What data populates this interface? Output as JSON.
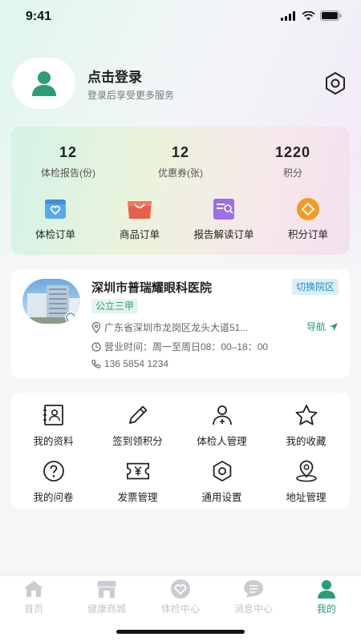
{
  "status_bar": {
    "time": "9:41"
  },
  "profile": {
    "title": "点击登录",
    "subtitle": "登录后享受更多服务"
  },
  "stats": [
    {
      "value": "12",
      "label": "体检报告(份)"
    },
    {
      "value": "12",
      "label": "优惠券(张)"
    },
    {
      "value": "1220",
      "label": "积分"
    }
  ],
  "orders": [
    {
      "label": "体检订单",
      "icon": "exam-order-icon"
    },
    {
      "label": "商品订单",
      "icon": "shopping-bag-icon"
    },
    {
      "label": "报告解读订单",
      "icon": "report-icon"
    },
    {
      "label": "积分订单",
      "icon": "points-icon"
    }
  ],
  "hospital": {
    "name": "深圳市普瑞耀眼科医院",
    "switch_label": "切换院区",
    "grade": "公立三甲",
    "address": "广东省深圳市龙岗区龙头大道51...",
    "nav_label": "导航",
    "hours": "营业时间：周一至周日08：00–18：00",
    "phone": "136 5854 1234"
  },
  "menu": [
    {
      "label": "我的资料",
      "icon": "profile-card-icon"
    },
    {
      "label": "签到领积分",
      "icon": "pencil-icon"
    },
    {
      "label": "体检人管理",
      "icon": "person-add-icon"
    },
    {
      "label": "我的收藏",
      "icon": "star-icon"
    },
    {
      "label": "我的问卷",
      "icon": "question-icon"
    },
    {
      "label": "发票管理",
      "icon": "invoice-icon"
    },
    {
      "label": "通用设置",
      "icon": "gear-icon"
    },
    {
      "label": "地址管理",
      "icon": "location-icon"
    }
  ],
  "tabs": [
    {
      "label": "首页",
      "icon": "home-icon",
      "active": false
    },
    {
      "label": "健康商城",
      "icon": "store-icon",
      "active": false
    },
    {
      "label": "体检中心",
      "icon": "heart-icon",
      "active": false
    },
    {
      "label": "消息中心",
      "icon": "message-icon",
      "active": false
    },
    {
      "label": "我的",
      "icon": "user-icon",
      "active": true
    }
  ],
  "colors": {
    "brand": "#2a9d78",
    "switch_bg": "#dbeefa",
    "switch_text": "#2a8ac9"
  }
}
